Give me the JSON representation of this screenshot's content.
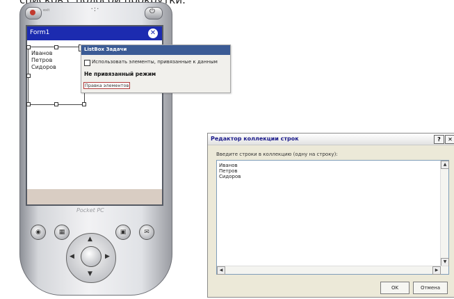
{
  "top_caption": "списков с полосой прокрутки.",
  "pda": {
    "power_label": "exit",
    "speaker_glyph": "·:·",
    "form": {
      "title": "Form1",
      "close_glyph": "✕"
    },
    "listbox_items": [
      "Иванов",
      "Петров",
      "Сидоров"
    ],
    "smart_tag_glyph": "◂",
    "brand": "Pocket PC",
    "buttons": {
      "calendar": "◉",
      "contacts": "▦",
      "inbox": "▣",
      "tasks": "✉"
    },
    "dpad": {
      "up": "▲",
      "down": "▼",
      "left": "◀",
      "right": "▶"
    }
  },
  "tasks_panel": {
    "title": "ListBox Задачи",
    "checkbox_label": "Использовать элементы, привязанные к данным",
    "mode_label": "Не привязанный режим",
    "link_label": "Правка элементов"
  },
  "dialog": {
    "title": "Редактор коллекции строк",
    "help_glyph": "?",
    "close_glyph": "✕",
    "prompt": "Введите строки в коллекцию (одну на строку):",
    "lines": [
      "Иванов",
      "Петров",
      "Сидоров"
    ],
    "ok_label": "OK",
    "cancel_label": "Отмена",
    "scroll_up": "▲",
    "scroll_down": "▼",
    "scroll_left": "◀",
    "scroll_right": "▶"
  },
  "colors": {
    "titlebar": "#1c2bb0",
    "tasks_header": "#3b5b95",
    "dialog_bg": "#ece9d8"
  }
}
